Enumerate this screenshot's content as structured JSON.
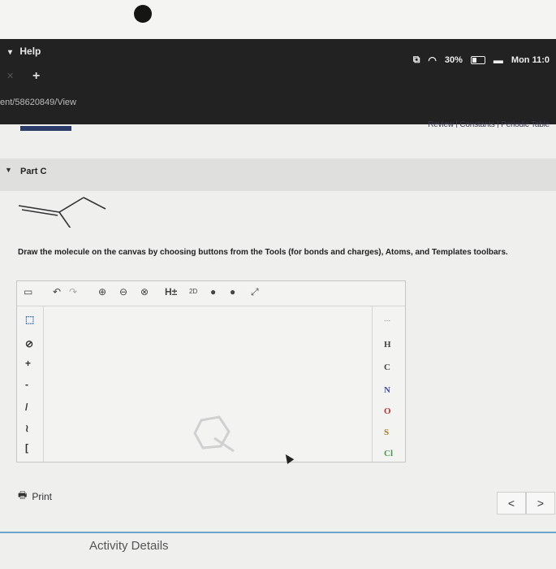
{
  "menubar": {
    "help_label": "Help",
    "battery_percent": "30%",
    "clock": "Mon 11:0"
  },
  "browser": {
    "new_tab_label": "+",
    "url_fragment": "ent/58620849/View"
  },
  "header_links": "Review | Constants | Periodic Table",
  "part": {
    "title": "Part C"
  },
  "instructions": "Draw the molecule on the canvas by choosing buttons from the Tools (for bonds and charges), Atoms, and Templates toolbars.",
  "editor": {
    "toolbar": {
      "h_label": "H±",
      "two_d_label": "2D"
    },
    "atoms": [
      "H",
      "C",
      "N",
      "O",
      "S",
      "Cl"
    ]
  },
  "footer": {
    "print_label": "Print",
    "prev_label": "<",
    "next_label": ">",
    "activity_label": "Activity Details"
  },
  "colors": {
    "accent_blue": "#2d3d6b",
    "divider_blue": "#6aa6c9"
  }
}
